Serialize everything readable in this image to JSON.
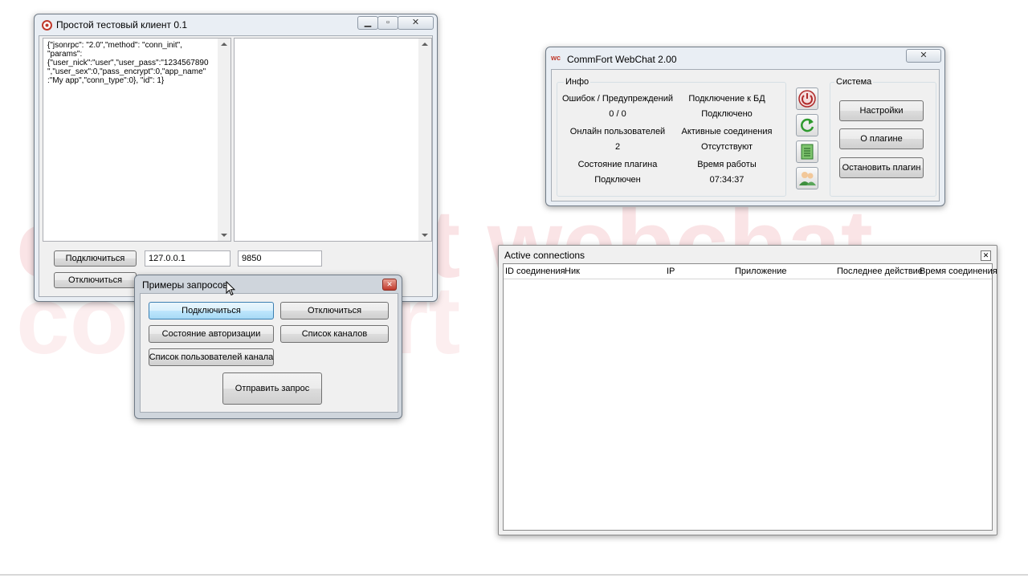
{
  "watermark": {
    "line1": "commfort webchat",
    "line2": "commfort",
    "color": "#d9232e"
  },
  "client_window": {
    "title": "Простой тестовый клиент 0.1",
    "request_text": "{\"jsonrpc\": \"2.0\",\"method\": \"conn_init\",\n\"params\":\n{\"user_nick\":\"user\",\"user_pass\":\"1234567890\n\",\"user_sex\":0,\"pass_encrypt\":0,\"app_name\"\n:\"My app\",\"conn_type\":0}, \"id\": 1}",
    "response_text": "",
    "connect_label": "Подключиться",
    "disconnect_label": "Отключиться",
    "host_value": "127.0.0.1",
    "port_value": "9850"
  },
  "examples_window": {
    "title": "Примеры запросов",
    "buttons": {
      "connect": "Подключиться",
      "disconnect": "Отключиться",
      "auth_state": "Состояние авторизации",
      "channel_list": "Список каналов",
      "channel_users": "Список пользователей канала",
      "send": "Отправить запрос"
    }
  },
  "webchat_window": {
    "title": "CommFort WebChat 2.00",
    "info_group": "Инфо",
    "errors_label": "Ошибок / Предупреждений",
    "errors_value": "0 / 0",
    "db_label": "Подключение к БД",
    "db_value": "Подключено",
    "online_label": "Онлайн пользователей",
    "online_value": "2",
    "active_conn_label": "Активные соединения",
    "active_conn_value": "Отсутствуют",
    "plugin_state_label": "Состояние плагина",
    "plugin_state_value": "Подключен",
    "uptime_label": "Время работы",
    "uptime_value": "07:34:37",
    "system_group": "Система",
    "settings_button": "Настройки",
    "about_button": "О плагине",
    "stop_button": "Остановить плагин"
  },
  "connections_window": {
    "title": "Active connections",
    "columns": [
      "ID соединения",
      "Ник",
      "IP",
      "Приложение",
      "Последнее действие",
      "Время соединения"
    ],
    "rows": []
  }
}
